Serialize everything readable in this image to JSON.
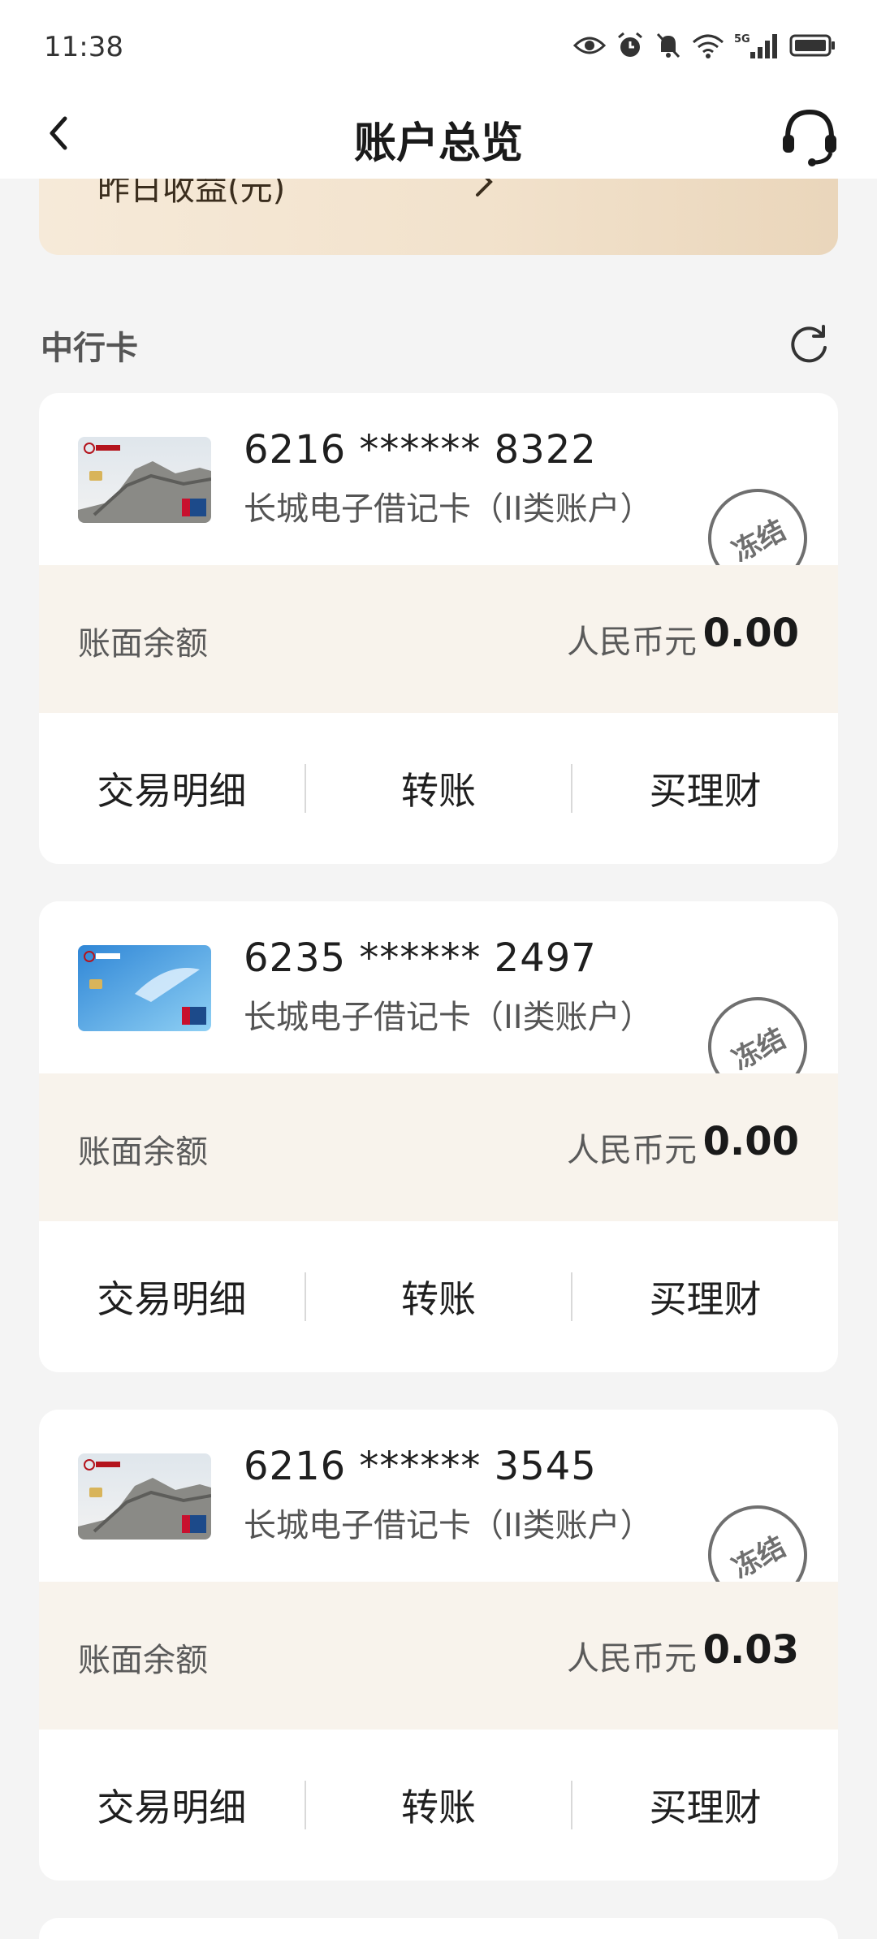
{
  "status_bar": {
    "time": "11:38",
    "network": "5G"
  },
  "header": {
    "title": "账户总览",
    "back_icon": "chevron-left-icon",
    "service_icon": "headset-icon"
  },
  "summary": {
    "label": "昨日收益(元)"
  },
  "section": {
    "title": "中行卡",
    "refresh_icon": "refresh-icon"
  },
  "cards": [
    {
      "number": "6216 ****** 8322",
      "type": "长城电子借记卡（II类账户）",
      "frozen_label": "冻结",
      "balance_label": "账面余额",
      "currency": "人民币元",
      "amount": "0.00",
      "actions": [
        "交易明细",
        "转账",
        "买理财"
      ]
    },
    {
      "number": "6235 ****** 2497",
      "type": "长城电子借记卡（II类账户）",
      "frozen_label": "冻结",
      "balance_label": "账面余额",
      "currency": "人民币元",
      "amount": "0.00",
      "actions": [
        "交易明细",
        "转账",
        "买理财"
      ]
    },
    {
      "number": "6216 ****** 3545",
      "type": "长城电子借记卡（II类账户）",
      "frozen_label": "冻结",
      "balance_label": "账面余额",
      "currency": "人民币元",
      "amount": "0.03",
      "actions": [
        "交易明细",
        "转账",
        "买理财"
      ]
    }
  ],
  "colors": {
    "balance_bg": "#f8f3ec",
    "banner_gold": "#f2e2cc",
    "stamp_gray": "#6f6f6f",
    "card_bg": "#ffffff",
    "page_bg": "#f4f4f4"
  }
}
